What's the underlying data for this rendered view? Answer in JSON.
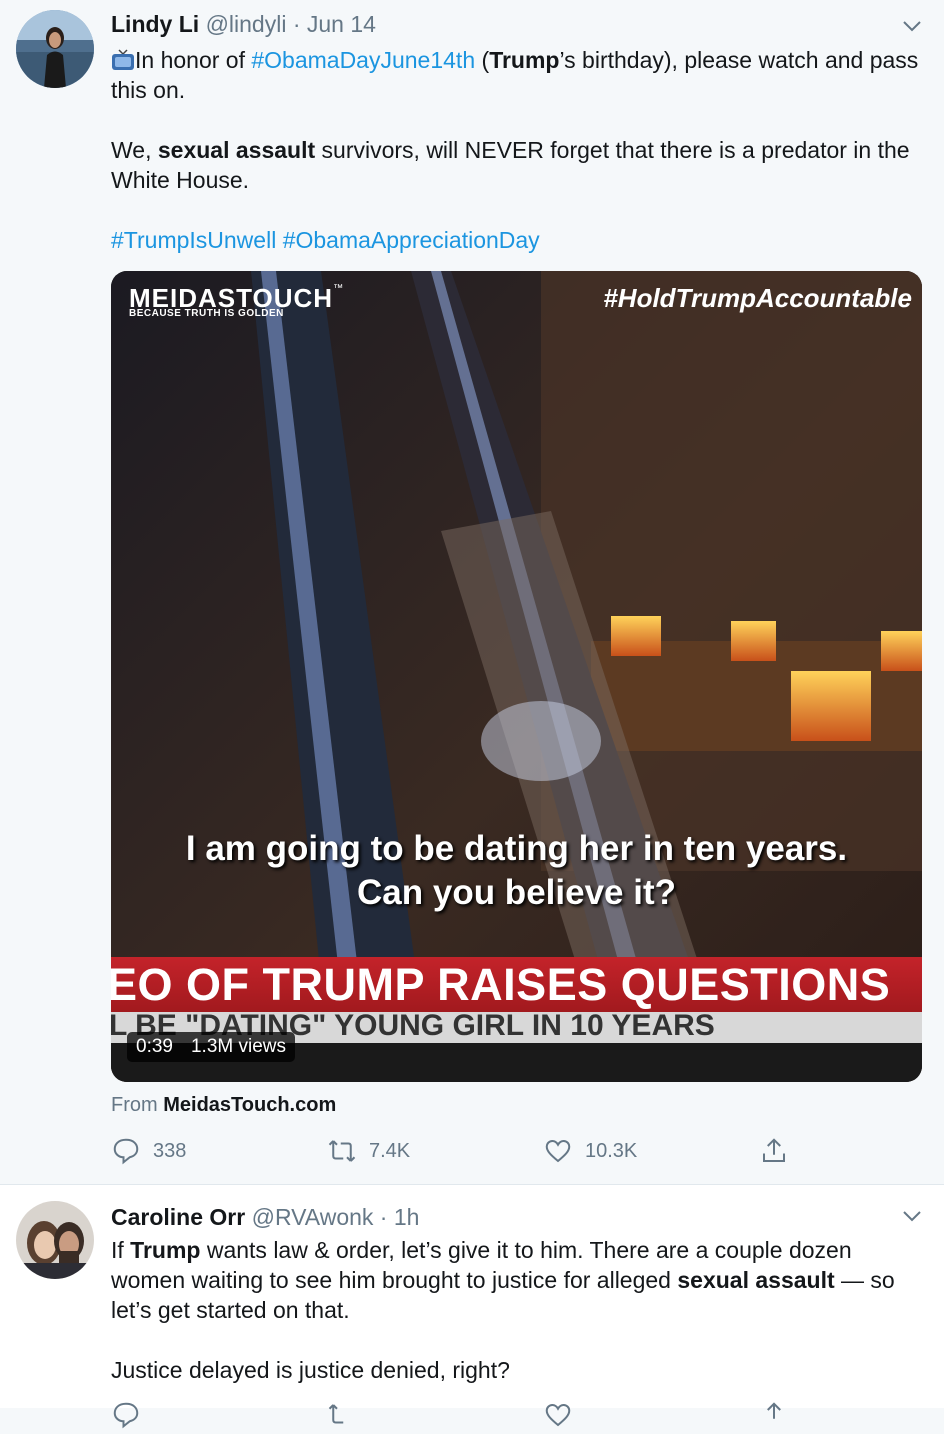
{
  "tweets": [
    {
      "name": "Lindy Li",
      "handle": "@lindyli",
      "sep": "·",
      "date": "Jun 14",
      "text": {
        "p1_icon": "television-icon",
        "p1_a": "In honor of ",
        "p1_tag": "#ObamaDayJune14th",
        "p1_b": " (",
        "p1_bold": "Trump",
        "p1_c": "’s birthday), please watch and pass this on.",
        "p2_a": "We, ",
        "p2_bold": "sexual assault",
        "p2_b": " survivors, will NEVER forget that there is a predator in the White House.",
        "tag1": "#TrumpIsUnwell",
        "tag2": "#ObamaAppreciationDay"
      },
      "media": {
        "logo_main": "MEIDASTOUCH",
        "logo_tm": "™",
        "logo_sub": "BECAUSE TRUTH IS GOLDEN",
        "hashtag_overlay": "#HoldTrumpAccountable",
        "caption_line1": "I am going to be dating her in ten years.",
        "caption_line2": "Can you believe it?",
        "ticker_line1": "EO OF TRUMP RAISES QUESTIONS",
        "ticker_line2": "L BE \"DATING\" YOUNG GIRL IN 10 YEARS",
        "duration": "0:39",
        "views": "1.3M views"
      },
      "from_label": "From",
      "from_source": "MeidasTouch.com",
      "actions": {
        "replies": "338",
        "retweets": "7.4K",
        "likes": "10.3K"
      }
    },
    {
      "name": "Caroline Orr",
      "handle": "@RVAwonk",
      "sep": "·",
      "date": "1h",
      "text": {
        "p1_a": "If ",
        "p1_bold": "Trump",
        "p1_b": " wants law & order, let’s give it to him. There are a couple dozen women waiting to see him brought to justice for alleged ",
        "p1_bold2": "sexual assault",
        "p1_c": " — so let’s get started on that.",
        "p2": "Justice delayed is justice denied, right?"
      }
    }
  ],
  "colors": {
    "link": "#1b95e0",
    "meta": "#657786",
    "background": "#f5f8fa",
    "ticker_red": "#b3191e"
  }
}
